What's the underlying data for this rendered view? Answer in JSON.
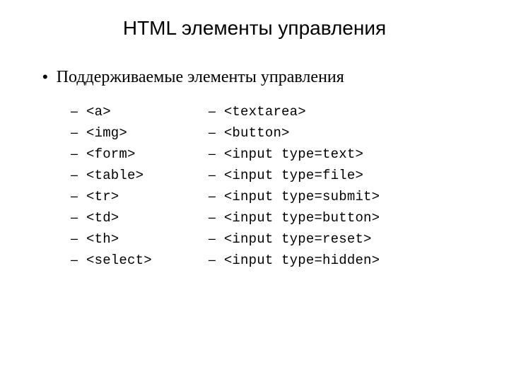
{
  "title": "HTML элементы управления",
  "bullet": {
    "marker": "•",
    "text": "Поддерживаемые элементы управления"
  },
  "dash": "–",
  "left_items": [
    "<a>",
    "<img>",
    "<form>",
    "<table>",
    "<tr>",
    "<td>",
    "<th>",
    "<select>"
  ],
  "right_items": [
    "<textarea>",
    "<button>",
    "<input type=text>",
    "<input type=file>",
    "<input type=submit>",
    "<input type=button>",
    "<input type=reset>",
    "<input type=hidden>"
  ]
}
